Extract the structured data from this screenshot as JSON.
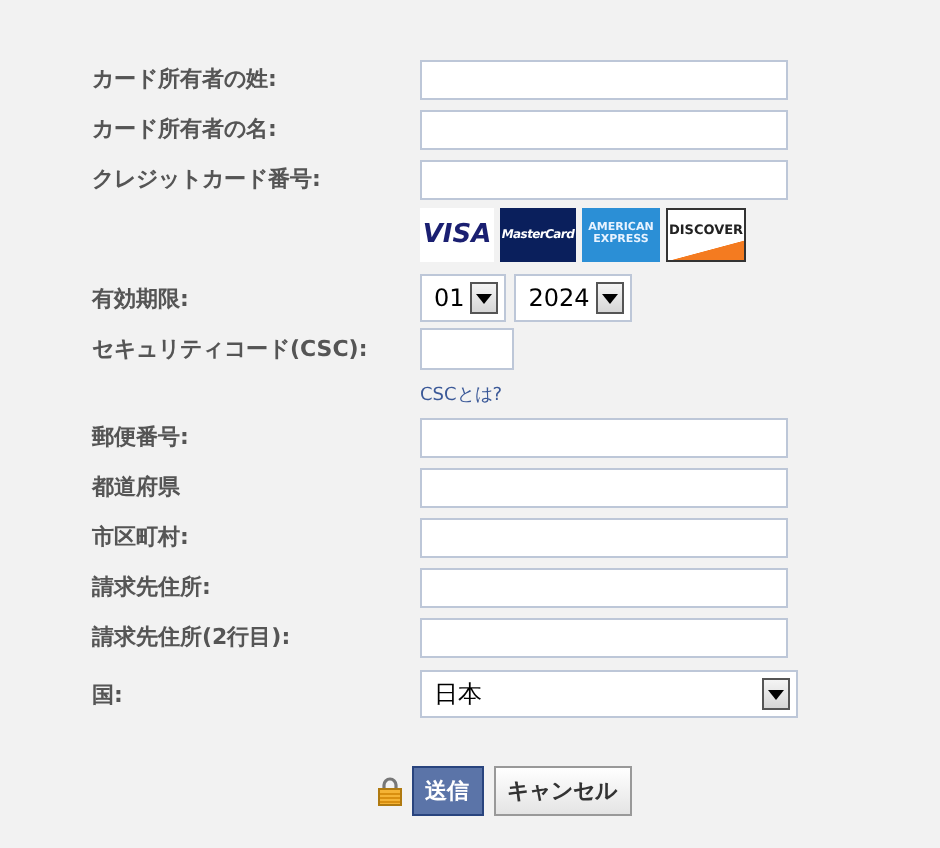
{
  "fields": [
    {
      "kind": "text",
      "label": "カード所有者の姓:"
    },
    {
      "kind": "text",
      "label": "カード所有者の名:"
    },
    {
      "kind": "text",
      "label": "クレジットカード番号:"
    },
    {
      "kind": "cards",
      "cards": [
        {
          "name": "VISA"
        },
        {
          "name": "MasterCard"
        },
        {
          "name": "AMERICAN EXPRESS"
        },
        {
          "name": "DISCOVER"
        }
      ]
    },
    {
      "kind": "expiry",
      "label": "有効期限:",
      "month": "01",
      "year": "2024"
    },
    {
      "kind": "short",
      "label": "セキュリティコード(CSC):"
    },
    {
      "kind": "link",
      "text": "CSCとは?"
    },
    {
      "kind": "text",
      "label": "郵便番号:"
    },
    {
      "kind": "text",
      "label": "都道府県"
    },
    {
      "kind": "text",
      "label": "市区町村:"
    },
    {
      "kind": "text",
      "label": "請求先住所:"
    },
    {
      "kind": "text",
      "label": "請求先住所(2行目):"
    },
    {
      "kind": "select",
      "label": "国:",
      "value": "日本"
    }
  ],
  "buttons": [
    {
      "label": "送信",
      "primary": true
    },
    {
      "label": "キャンセル",
      "primary": false
    }
  ]
}
